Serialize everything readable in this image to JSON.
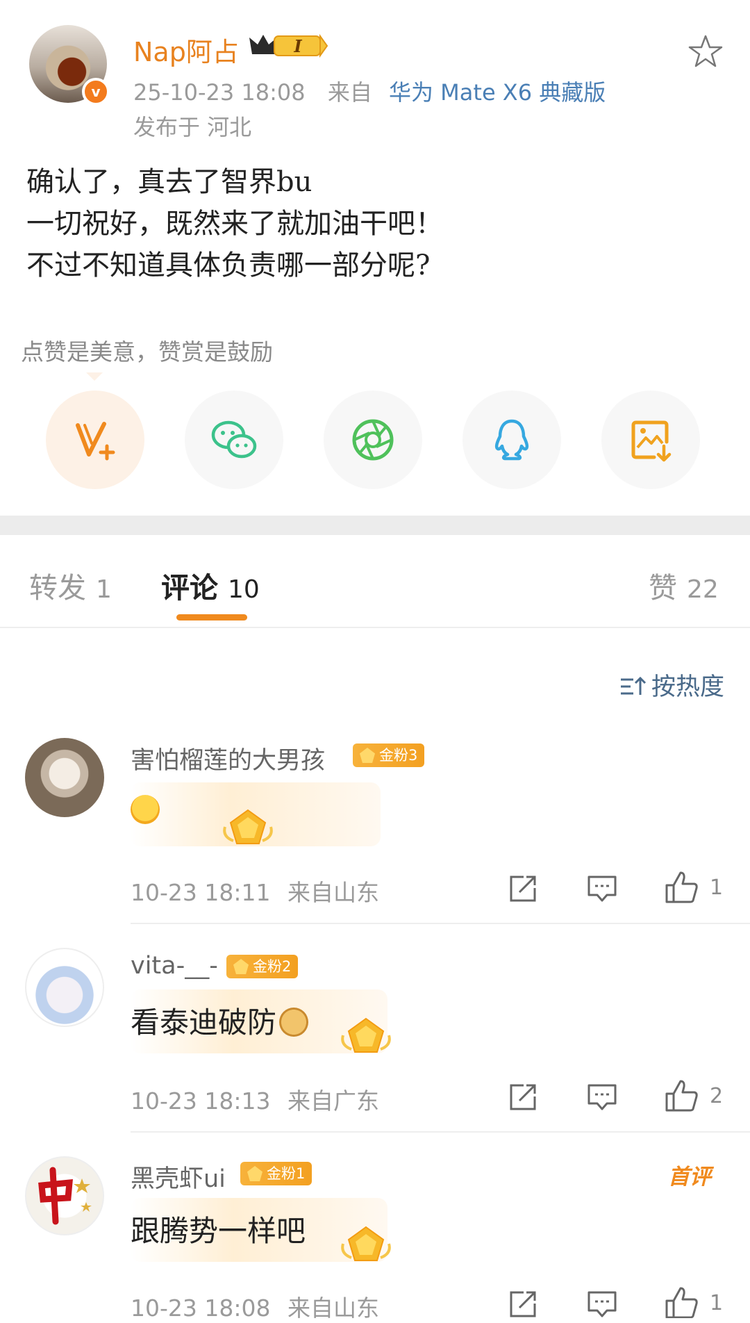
{
  "post": {
    "username": "Nap阿占",
    "member_level": "I",
    "timestamp": "25-10-23 18:08",
    "source_prefix": "来自",
    "device": "华为 Mate X6 典藏版",
    "location": "发布于 河北",
    "body_lines": [
      "确认了，真去了智界bu",
      "一切祝好，既然来了就加油干吧！",
      "不过不知道具体负责哪一部分呢?"
    ],
    "reward_hint": "点赞是美意，赞赏是鼓励",
    "share_icons": [
      "v-plus-icon",
      "wechat-icon",
      "moments-icon",
      "qq-icon",
      "save-image-icon"
    ],
    "colors": {
      "accent": "#f08a1e",
      "link": "#4a7fb5"
    }
  },
  "tabs": {
    "repost": {
      "label": "转发",
      "count": "1"
    },
    "comments": {
      "label": "评论",
      "count": "10"
    },
    "likes": {
      "label": "赞",
      "count": "22"
    }
  },
  "sort_label": "按热度",
  "comments": [
    {
      "username": "害怕榴莲的大男孩",
      "badge": "金粉3",
      "text": "",
      "emoji": "laughing-face-icon",
      "time": "10-23 18:11",
      "location": "来自山东",
      "likes": "1"
    },
    {
      "username": "vita-__-",
      "badge": "金粉2",
      "text": "看泰迪破防",
      "emoji": "doge-icon",
      "time": "10-23 18:13",
      "location": "来自广东",
      "likes": "2"
    },
    {
      "username": "黑壳虾ui",
      "badge": "金粉1",
      "text": "跟腾势一样吧",
      "emoji": "",
      "time": "10-23 18:08",
      "location": "来自山东",
      "likes": "1",
      "first_comment": "首评"
    }
  ]
}
